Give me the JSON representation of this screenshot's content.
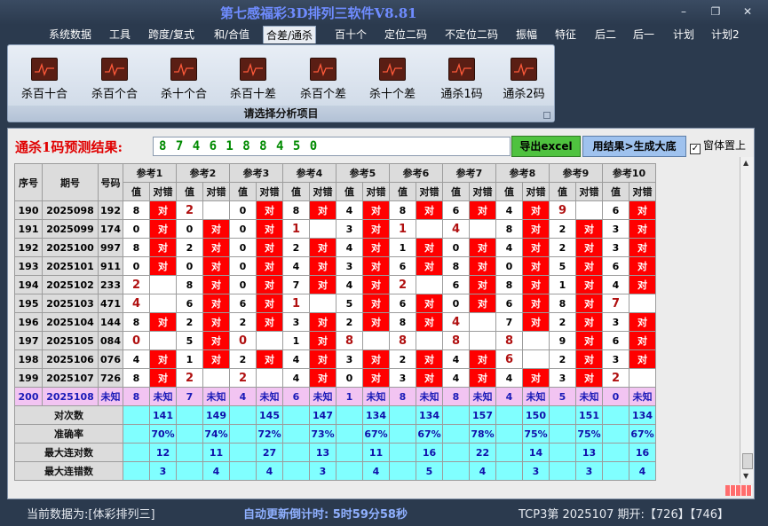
{
  "app": {
    "title": "第七感福彩3D排列三软件V8.81",
    "window_controls": {
      "minimize": "–",
      "maximize": "❐",
      "close": "✕"
    }
  },
  "menu": [
    {
      "label": "系统数据",
      "active": false
    },
    {
      "label": "工具",
      "active": false
    },
    {
      "label": "跨度/复式",
      "active": false
    },
    {
      "label": "和/合值",
      "active": false
    },
    {
      "label": "合差/通杀",
      "active": true
    },
    {
      "label": "百十个",
      "active": false
    },
    {
      "label": "定位二码",
      "active": false
    },
    {
      "label": "不定位二码",
      "active": false
    },
    {
      "label": "振幅",
      "active": false
    },
    {
      "label": "特征",
      "active": false
    },
    {
      "label": "后二",
      "active": false
    },
    {
      "label": "后一",
      "active": false
    },
    {
      "label": "计划",
      "active": false
    },
    {
      "label": "计划2",
      "active": false
    }
  ],
  "ribbon": {
    "buttons": [
      {
        "label": "杀百十合",
        "icon": "chart-icon"
      },
      {
        "label": "杀百个合",
        "icon": "chart-icon"
      },
      {
        "label": "杀十个合",
        "icon": "chart-icon"
      },
      {
        "label": "杀百十差",
        "icon": "chart-icon"
      },
      {
        "label": "杀百个差",
        "icon": "chart-icon"
      },
      {
        "label": "杀十个差",
        "icon": "chart-icon"
      },
      {
        "label": "通杀1码",
        "icon": "chart-icon"
      },
      {
        "label": "通杀2码",
        "icon": "chart-icon"
      }
    ],
    "caption": "请选择分析项目"
  },
  "prediction": {
    "label": "通杀1码预测结果:",
    "value": "8 7 4 6 1 8 8 4 5 0",
    "excel_button": "导出excel",
    "generate_button": "用结果>生成大底",
    "pin_checkbox": "窗体置上",
    "pin_checked": true
  },
  "table": {
    "headers": {
      "seq": "序号",
      "period": "期号",
      "code": "号码",
      "value": "值",
      "result": "对错"
    },
    "refs": [
      "参考1",
      "参考2",
      "参考3",
      "参考4",
      "参考5",
      "参考6",
      "参考7",
      "参考8",
      "参考9",
      "参考10"
    ],
    "ok_text": "对",
    "rows": [
      {
        "seq": "190",
        "period": "2025098",
        "code": "192",
        "cells": [
          [
            "8",
            1
          ],
          [
            "2",
            0
          ],
          [
            "0",
            1
          ],
          [
            "8",
            1
          ],
          [
            "4",
            1
          ],
          [
            "8",
            1
          ],
          [
            "6",
            1
          ],
          [
            "4",
            1
          ],
          [
            "9",
            0
          ],
          [
            "6",
            1
          ]
        ]
      },
      {
        "seq": "191",
        "period": "2025099",
        "code": "174",
        "cells": [
          [
            "0",
            1
          ],
          [
            "0",
            1
          ],
          [
            "0",
            1
          ],
          [
            "1",
            0
          ],
          [
            "3",
            1
          ],
          [
            "1",
            0
          ],
          [
            "4",
            0
          ],
          [
            "8",
            1
          ],
          [
            "2",
            1
          ],
          [
            "3",
            1
          ]
        ]
      },
      {
        "seq": "192",
        "period": "2025100",
        "code": "997",
        "cells": [
          [
            "8",
            1
          ],
          [
            "2",
            1
          ],
          [
            "0",
            1
          ],
          [
            "2",
            1
          ],
          [
            "4",
            1
          ],
          [
            "1",
            1
          ],
          [
            "0",
            1
          ],
          [
            "4",
            1
          ],
          [
            "2",
            1
          ],
          [
            "3",
            1
          ]
        ]
      },
      {
        "seq": "193",
        "period": "2025101",
        "module": "",
        "code": "911",
        "cells": [
          [
            "0",
            1
          ],
          [
            "0",
            1
          ],
          [
            "0",
            1
          ],
          [
            "4",
            1
          ],
          [
            "3",
            1
          ],
          [
            "6",
            1
          ],
          [
            "8",
            1
          ],
          [
            "0",
            1
          ],
          [
            "5",
            1
          ],
          [
            "6",
            1
          ]
        ]
      },
      {
        "seq": "194",
        "period": "2025102",
        "code": "233",
        "cells": [
          [
            "2",
            0
          ],
          [
            "8",
            1
          ],
          [
            "0",
            1
          ],
          [
            "7",
            1
          ],
          [
            "4",
            1
          ],
          [
            "2",
            0
          ],
          [
            "6",
            1
          ],
          [
            "8",
            1
          ],
          [
            "1",
            1
          ],
          [
            "4",
            1
          ]
        ]
      },
      {
        "seq": "195",
        "period": "2025103",
        "code": "471",
        "cells": [
          [
            "4",
            0
          ],
          [
            "6",
            1
          ],
          [
            "6",
            1
          ],
          [
            "1",
            0
          ],
          [
            "5",
            1
          ],
          [
            "6",
            1
          ],
          [
            "0",
            1
          ],
          [
            "6",
            1
          ],
          [
            "8",
            1
          ],
          [
            "7",
            0
          ]
        ]
      },
      {
        "seq": "196",
        "period": "2025104",
        "code": "144",
        "cells": [
          [
            "8",
            1
          ],
          [
            "2",
            1
          ],
          [
            "2",
            1
          ],
          [
            "3",
            1
          ],
          [
            "2",
            1
          ],
          [
            "8",
            1
          ],
          [
            "4",
            0
          ],
          [
            "7",
            1
          ],
          [
            "2",
            1
          ],
          [
            "3",
            1
          ]
        ]
      },
      {
        "seq": "197",
        "period": "2025105",
        "code": "084",
        "cells": [
          [
            "0",
            0
          ],
          [
            "5",
            1
          ],
          [
            "0",
            0
          ],
          [
            "1",
            1
          ],
          [
            "8",
            0
          ],
          [
            "8",
            0
          ],
          [
            "8",
            0
          ],
          [
            "8",
            0
          ],
          [
            "9",
            1
          ],
          [
            "6",
            1
          ]
        ]
      },
      {
        "seq": "198",
        "period": "2025106",
        "code": "076",
        "cells": [
          [
            "4",
            1
          ],
          [
            "1",
            1
          ],
          [
            "2",
            1
          ],
          [
            "4",
            1
          ],
          [
            "3",
            1
          ],
          [
            "2",
            1
          ],
          [
            "4",
            1
          ],
          [
            "6",
            0
          ],
          [
            "2",
            1
          ],
          [
            "3",
            1
          ]
        ]
      },
      {
        "seq": "199",
        "period": "2025107",
        "code": "726",
        "cells": [
          [
            "8",
            1
          ],
          [
            "2",
            0
          ],
          [
            "2",
            0
          ],
          [
            "4",
            1
          ],
          [
            "0",
            1
          ],
          [
            "3",
            1
          ],
          [
            "4",
            1
          ],
          [
            "4",
            1
          ],
          [
            "3",
            1
          ],
          [
            "2",
            0
          ]
        ]
      }
    ],
    "future": {
      "seq": "200",
      "period": "2025108",
      "code": "未知",
      "unknown": "未知",
      "values": [
        "8",
        "7",
        "4",
        "6",
        "1",
        "8",
        "8",
        "4",
        "5",
        "0"
      ]
    },
    "stats": [
      {
        "label": "对次数",
        "values": [
          "141",
          "149",
          "145",
          "147",
          "134",
          "134",
          "157",
          "150",
          "151",
          "134"
        ]
      },
      {
        "label": "准确率",
        "values": [
          "70%",
          "74%",
          "72%",
          "73%",
          "67%",
          "67%",
          "78%",
          "75%",
          "75%",
          "67%"
        ]
      },
      {
        "label": "最大连对数",
        "values": [
          "12",
          "11",
          "27",
          "13",
          "11",
          "16",
          "22",
          "14",
          "13",
          "16"
        ]
      },
      {
        "label": "最大连错数",
        "values": [
          "3",
          "4",
          "4",
          "3",
          "4",
          "5",
          "4",
          "3",
          "3",
          "4"
        ]
      }
    ]
  },
  "status": {
    "current_data": "当前数据为:[体彩排列三]",
    "countdown": "自动更新倒计时: 5时59分58秒",
    "latest": "TCP3第 2025107 期开:【726】【746】"
  }
}
